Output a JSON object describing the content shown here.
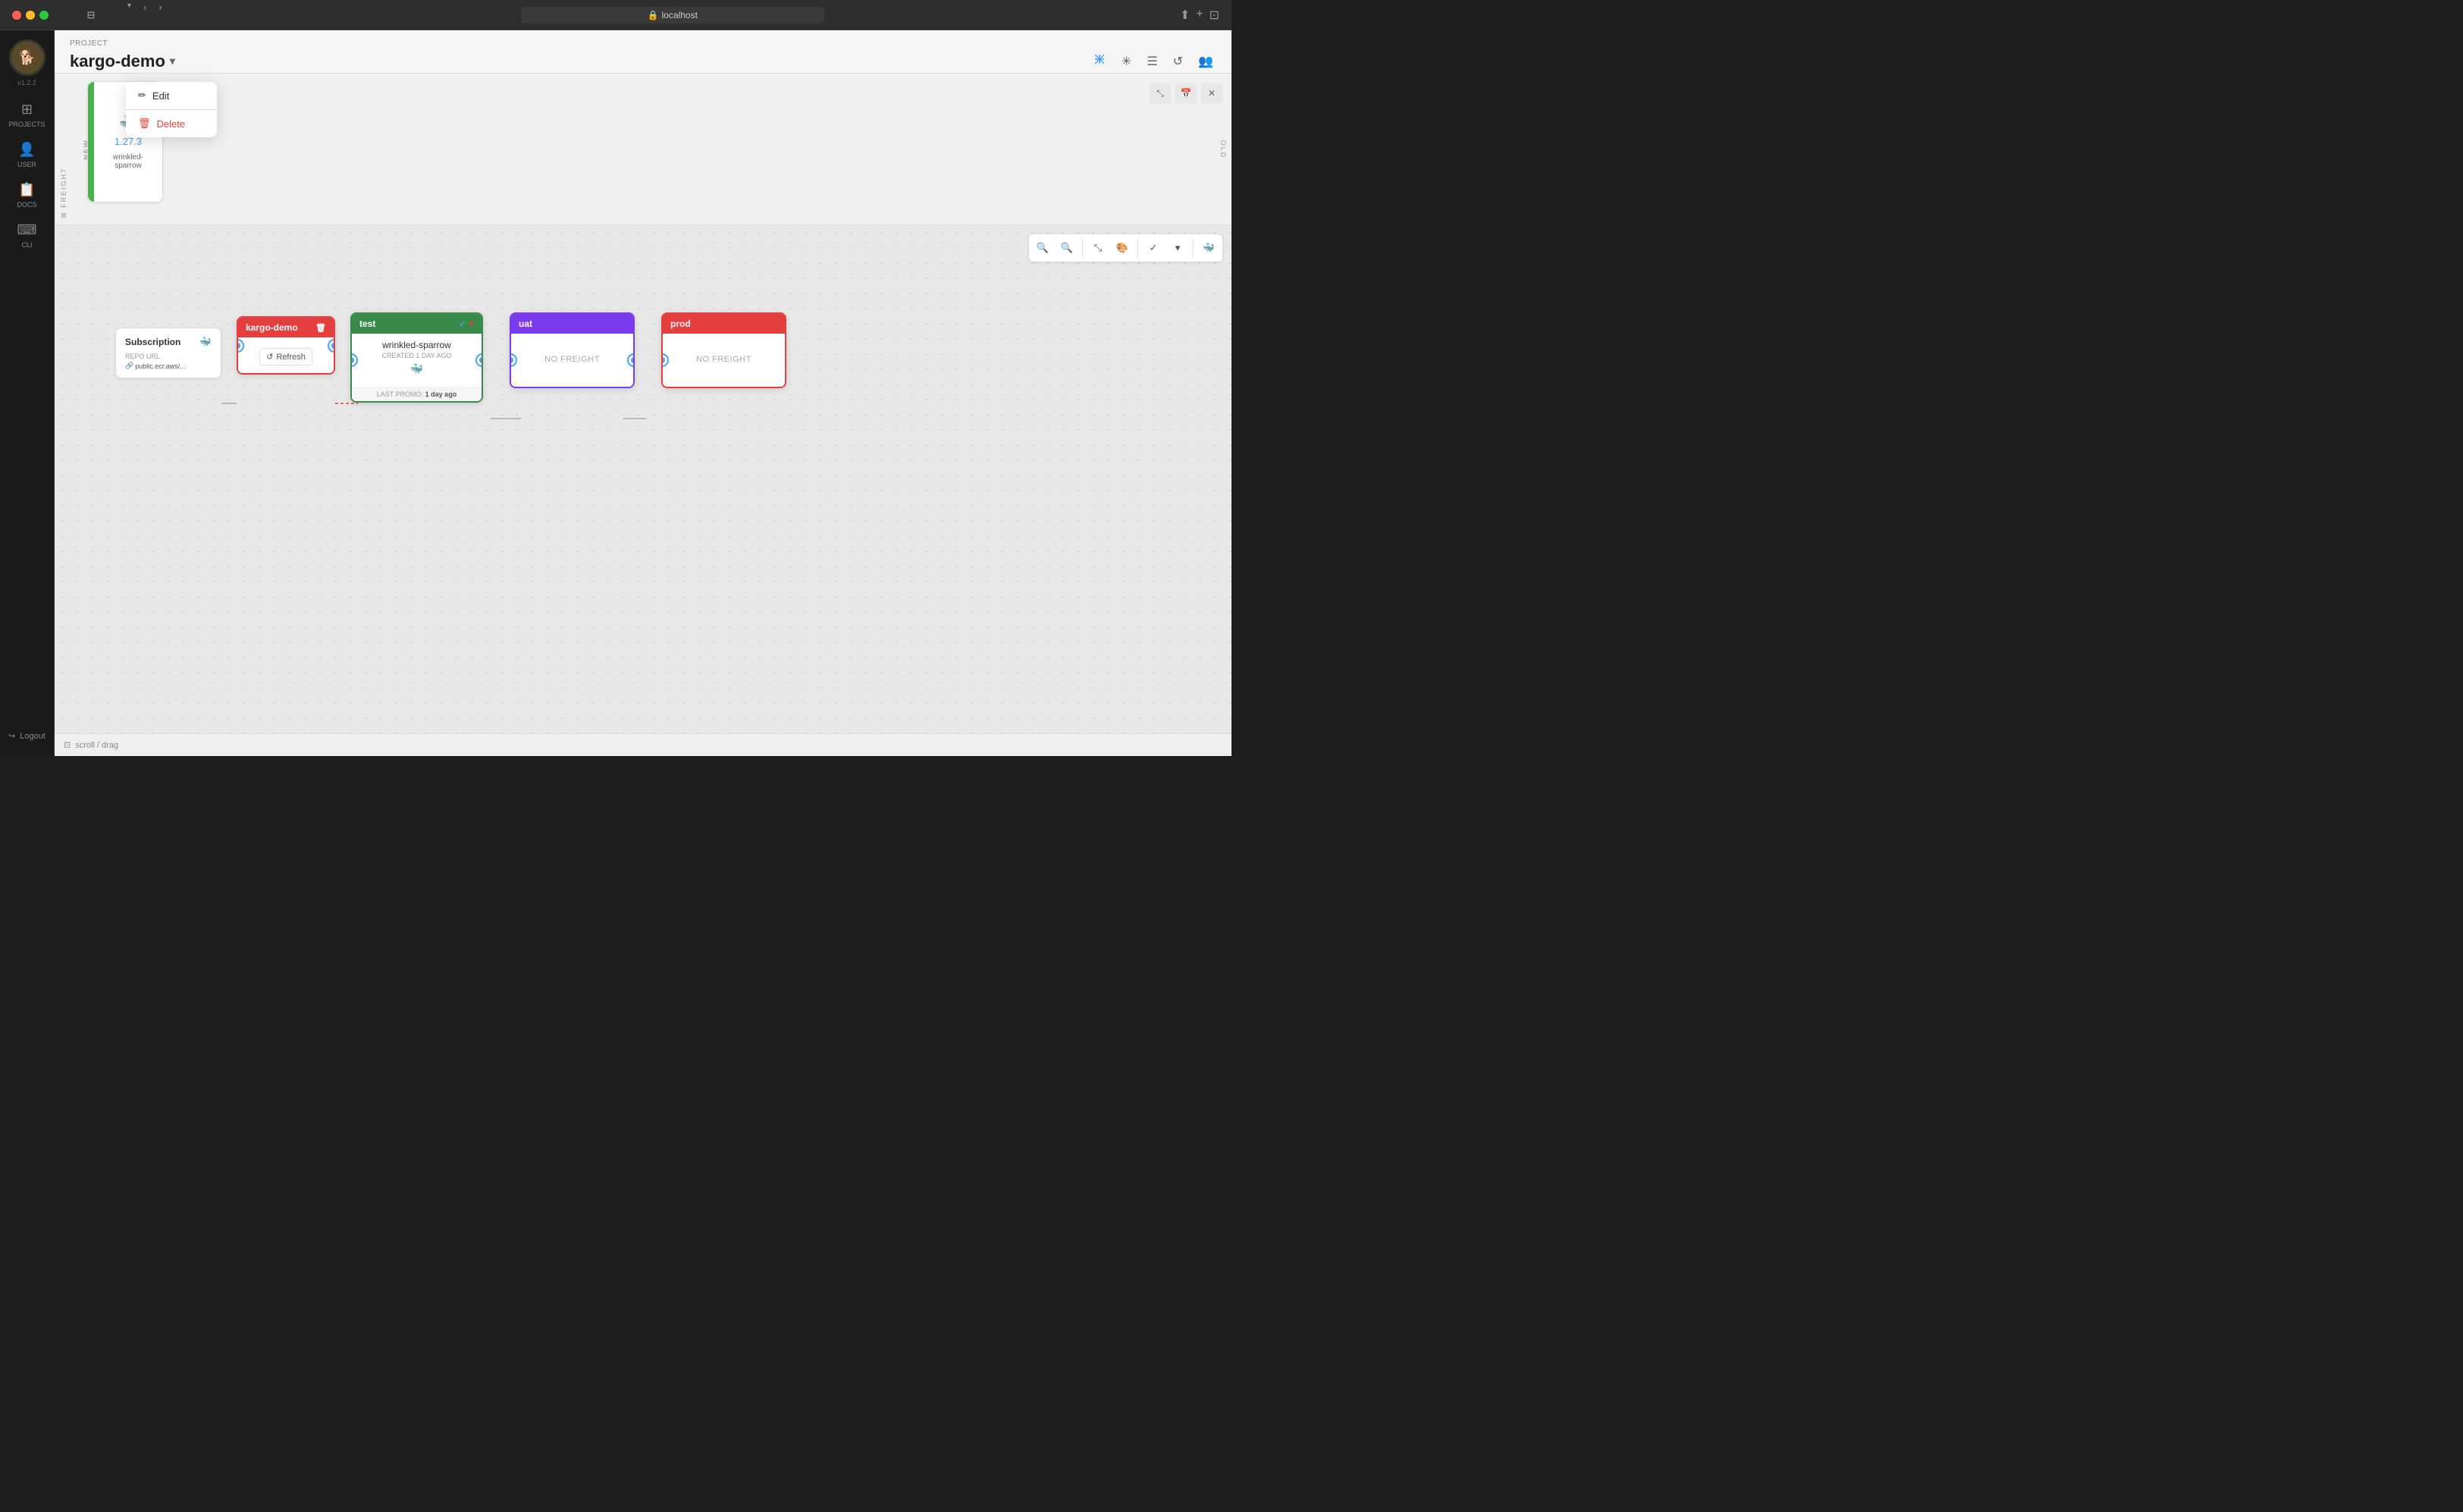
{
  "browser": {
    "url": "localhost",
    "lock_icon": "🔒"
  },
  "sidebar": {
    "version": "v1.2.2",
    "logo_emoji": "🐕",
    "nav_items": [
      {
        "id": "projects",
        "label": "PROJECTS",
        "icon": "⊞"
      },
      {
        "id": "user",
        "label": "USER",
        "icon": "👤"
      },
      {
        "id": "docs",
        "label": "DOCS",
        "icon": "📄"
      },
      {
        "id": "cli",
        "label": "CLI",
        "icon": "⌨"
      }
    ],
    "logout_label": "Logout"
  },
  "header": {
    "project_label": "PROJECT",
    "project_name": "kargo-demo",
    "actions": {
      "network_icon": "network",
      "asterisk_icon": "asterisk",
      "list_icon": "list",
      "history_icon": "history",
      "users_icon": "users"
    }
  },
  "dropdown": {
    "edit_label": "Edit",
    "delete_label": "Delete"
  },
  "freight_section": {
    "new_label": "NEW",
    "old_label": "OLD",
    "freight_label": "FREIGHT",
    "card": {
      "version": "1.27.3",
      "name": "wrinkled-sparrow",
      "docker_icon": "🐳"
    }
  },
  "pipeline": {
    "subscription_node": {
      "title": "Subscription",
      "docker_icon": "🐳",
      "repo_url_label": "REPO URL",
      "repo_url": "public.ecr.aws/..."
    },
    "kargo_node": {
      "title": "kargo-demo",
      "refresh_label": "Refresh",
      "trash_icon": "🗑"
    },
    "stages": [
      {
        "id": "test",
        "title": "test",
        "color": "#3a8a4a",
        "border_color": "#3a8a4a",
        "has_freight": true,
        "freight_name": "wrinkled-sparrow",
        "created_label": "CREATED 1 DAY AGO",
        "docker_icon": "🐳",
        "last_promo_label": "LAST PROMO:",
        "last_promo_value": "1 day ago"
      },
      {
        "id": "uat",
        "title": "uat",
        "color": "#7c3aed",
        "border_color": "#7c3aed",
        "has_freight": false,
        "no_freight_label": "NO FREIGHT"
      },
      {
        "id": "prod",
        "title": "prod",
        "color": "#e53e3e",
        "border_color": "#e53e3e",
        "has_freight": false,
        "no_freight_label": "NO FREIGHT"
      }
    ],
    "scroll_hint": "scroll / drag"
  }
}
